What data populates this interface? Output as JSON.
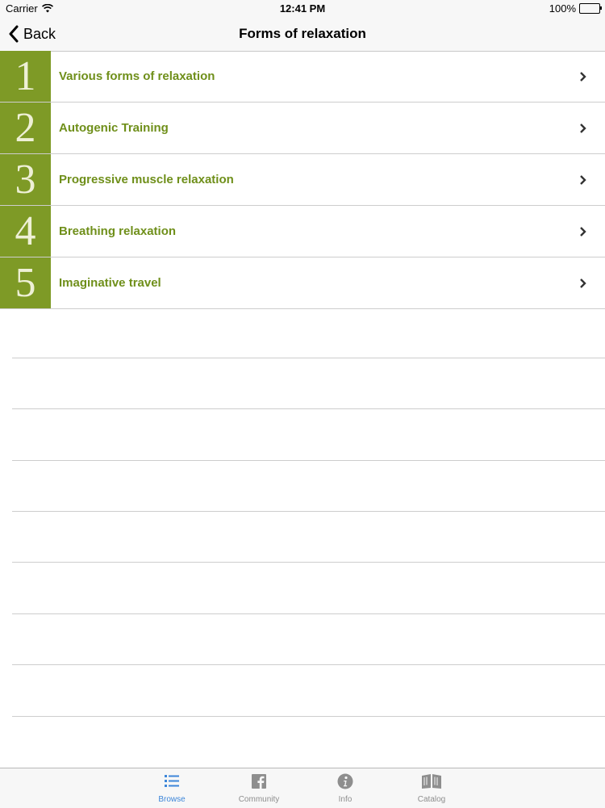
{
  "status_bar": {
    "carrier": "Carrier",
    "time": "12:41 PM",
    "battery": "100%"
  },
  "nav": {
    "back_label": "Back",
    "title": "Forms of relaxation"
  },
  "list": {
    "items": [
      {
        "number": "1",
        "label": "Various forms of relaxation"
      },
      {
        "number": "2",
        "label": "Autogenic Training"
      },
      {
        "number": "3",
        "label": "Progressive muscle relaxation"
      },
      {
        "number": "4",
        "label": "Breathing relaxation"
      },
      {
        "number": "5",
        "label": "Imaginative travel"
      }
    ]
  },
  "tabs": [
    {
      "label": "Browse",
      "icon": "list-icon",
      "active": true
    },
    {
      "label": "Community",
      "icon": "facebook-icon",
      "active": false
    },
    {
      "label": "Info",
      "icon": "info-icon",
      "active": false
    },
    {
      "label": "Catalog",
      "icon": "book-icon",
      "active": false
    }
  ],
  "colors": {
    "accent_green": "#7e9a26",
    "label_green": "#6f8f1a",
    "active_tab": "#3d86d9"
  }
}
